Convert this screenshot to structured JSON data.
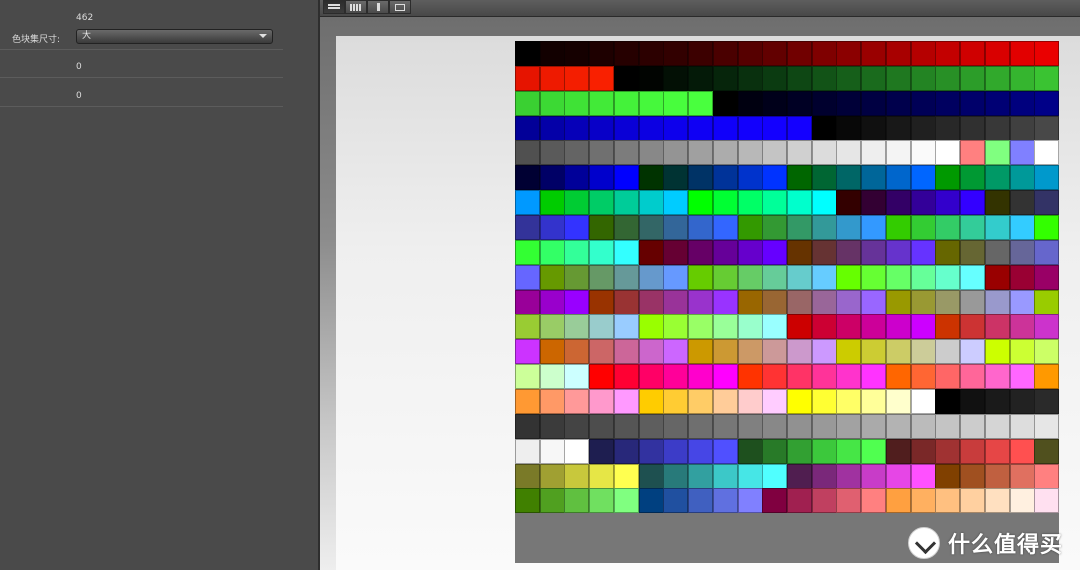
{
  "panel": {
    "count": "462",
    "size_label": "色块集尺寸:",
    "size_value": "大",
    "field1": "0",
    "field2": "0"
  },
  "toolbar": {
    "buttons": [
      "list-view-icon",
      "grid-view-icon",
      "split-view-icon",
      "image-view-icon"
    ],
    "active": "list-view-icon"
  },
  "swatches": {
    "columns": 22,
    "rows": 21,
    "colors": [
      "#000000",
      "#120000",
      "#150000",
      "#1e0000",
      "#260000",
      "#2c0000",
      "#320000",
      "#3c0000",
      "#4a0000",
      "#560000",
      "#620000",
      "#710000",
      "#7f0000",
      "#8b0000",
      "#9a0000",
      "#a80000",
      "#b50000",
      "#c30000",
      "#cf0000",
      "#d90000",
      "#e20000",
      "#ea0000",
      "#e61400",
      "#ee1a00",
      "#f41e00",
      "#f92000",
      "#000000",
      "#010401",
      "#031005",
      "#041a08",
      "#06250b",
      "#09300e",
      "#0b3b11",
      "#0e4714",
      "#125317",
      "#165f1a",
      "#1a6b1d",
      "#1f7820",
      "#238423",
      "#289026",
      "#2c9d29",
      "#31a92c",
      "#35b52f",
      "#3ac332",
      "#3ad032",
      "#3cd934",
      "#3fe236",
      "#42ea38",
      "#44f23a",
      "#46f83c",
      "#48fd3d",
      "#49ff3e",
      "#000000",
      "#000010",
      "#00001a",
      "#000024",
      "#00002e",
      "#000038",
      "#000042",
      "#00004c",
      "#000056",
      "#000060",
      "#00006a",
      "#000074",
      "#00007e",
      "#000088",
      "#020098",
      "#0400a8",
      "#0600b8",
      "#0800c8",
      "#0a00d6",
      "#0c00e2",
      "#0d00ec",
      "#0f00f4",
      "#1000fa",
      "#1200fd",
      "#1300ff",
      "#1400ff",
      "#000000",
      "#080808",
      "#101010",
      "#181818",
      "#202020",
      "#282828",
      "#303030",
      "#383838",
      "#404040",
      "#484848",
      "#505050",
      "#5a5a5a",
      "#646464",
      "#707070",
      "#7c7c7c",
      "#888888",
      "#949494",
      "#a0a0a0",
      "#acacac",
      "#b8b8b8",
      "#c4c4c4",
      "#d0d0d0",
      "#dcdcdc",
      "#e6e6e6",
      "#eeeeee",
      "#f4f4f4",
      "#fafafa",
      "#ffffff",
      "#ff8080",
      "#80ff80",
      "#8080ff",
      "#ffffff",
      "#000033",
      "#000066",
      "#000099",
      "#0000cc",
      "#0000ff",
      "#003300",
      "#003333",
      "#003366",
      "#003399",
      "#0033cc",
      "#0033ff",
      "#006600",
      "#006633",
      "#006666",
      "#006699",
      "#0066cc",
      "#0066ff",
      "#009900",
      "#009933",
      "#009966",
      "#009999",
      "#0099cc",
      "#0099ff",
      "#00cc00",
      "#00cc33",
      "#00cc66",
      "#00cc99",
      "#00cccc",
      "#00ccff",
      "#00ff00",
      "#00ff33",
      "#00ff66",
      "#00ff99",
      "#00ffcc",
      "#00ffff",
      "#330000",
      "#330033",
      "#330066",
      "#330099",
      "#3300cc",
      "#3300ff",
      "#333300",
      "#333333",
      "#333366",
      "#333399",
      "#3333cc",
      "#3333ff",
      "#336600",
      "#336633",
      "#336666",
      "#336699",
      "#3366cc",
      "#3366ff",
      "#339900",
      "#339933",
      "#339966",
      "#339999",
      "#3399cc",
      "#3399ff",
      "#33cc00",
      "#33cc33",
      "#33cc66",
      "#33cc99",
      "#33cccc",
      "#33ccff",
      "#33ff00",
      "#33ff33",
      "#33ff66",
      "#33ff99",
      "#33ffcc",
      "#33ffff",
      "#660000",
      "#660033",
      "#660066",
      "#660099",
      "#6600cc",
      "#6600ff",
      "#663300",
      "#663333",
      "#663366",
      "#663399",
      "#6633cc",
      "#6633ff",
      "#666600",
      "#666633",
      "#666666",
      "#666699",
      "#6666cc",
      "#6666ff",
      "#669900",
      "#669933",
      "#669966",
      "#669999",
      "#6699cc",
      "#6699ff",
      "#66cc00",
      "#66cc33",
      "#66cc66",
      "#66cc99",
      "#66cccc",
      "#66ccff",
      "#66ff00",
      "#66ff33",
      "#66ff66",
      "#66ff99",
      "#66ffcc",
      "#66ffff",
      "#990000",
      "#990033",
      "#990066",
      "#990099",
      "#9900cc",
      "#9900ff",
      "#993300",
      "#993333",
      "#993366",
      "#993399",
      "#9933cc",
      "#9933ff",
      "#996600",
      "#996633",
      "#996666",
      "#996699",
      "#9966cc",
      "#9966ff",
      "#999900",
      "#999933",
      "#999966",
      "#999999",
      "#9999cc",
      "#9999ff",
      "#99cc00",
      "#99cc33",
      "#99cc66",
      "#99cc99",
      "#99cccc",
      "#99ccff",
      "#99ff00",
      "#99ff33",
      "#99ff66",
      "#99ff99",
      "#99ffcc",
      "#99ffff",
      "#cc0000",
      "#cc0033",
      "#cc0066",
      "#cc0099",
      "#cc00cc",
      "#cc00ff",
      "#cc3300",
      "#cc3333",
      "#cc3366",
      "#cc3399",
      "#cc33cc",
      "#cc33ff",
      "#cc6600",
      "#cc6633",
      "#cc6666",
      "#cc6699",
      "#cc66cc",
      "#cc66ff",
      "#cc9900",
      "#cc9933",
      "#cc9966",
      "#cc9999",
      "#cc99cc",
      "#cc99ff",
      "#cccc00",
      "#cccc33",
      "#cccc66",
      "#cccc99",
      "#cccccc",
      "#ccccff",
      "#ccff00",
      "#ccff33",
      "#ccff66",
      "#ccff99",
      "#ccffcc",
      "#ccffff",
      "#ff0000",
      "#ff0033",
      "#ff0066",
      "#ff0099",
      "#ff00cc",
      "#ff00ff",
      "#ff3300",
      "#ff3333",
      "#ff3366",
      "#ff3399",
      "#ff33cc",
      "#ff33ff",
      "#ff6600",
      "#ff6633",
      "#ff6666",
      "#ff6699",
      "#ff66cc",
      "#ff66ff",
      "#ff9900",
      "#ff9933",
      "#ff9966",
      "#ff9999",
      "#ff99cc",
      "#ff99ff",
      "#ffcc00",
      "#ffcc33",
      "#ffcc66",
      "#ffcc99",
      "#ffcccc",
      "#ffccff",
      "#ffff00",
      "#ffff33",
      "#ffff66",
      "#ffff99",
      "#ffffcc",
      "#ffffff",
      "#000000",
      "#111111",
      "#1a1a1a",
      "#222222",
      "#2a2a2a",
      "#333333",
      "#3b3b3b",
      "#444444",
      "#4d4d4d",
      "#555555",
      "#5e5e5e",
      "#666666",
      "#6f6f6f",
      "#777777",
      "#808080",
      "#888888",
      "#919191",
      "#999999",
      "#a2a2a2",
      "#aaaaaa",
      "#b3b3b3",
      "#bbbbbb",
      "#c4c4c4",
      "#cccccc",
      "#d5d5d5",
      "#dddddd",
      "#e6e6e6",
      "#eeeeee",
      "#f7f7f7",
      "#ffffff",
      "#1e1e50",
      "#28287a",
      "#3232a0",
      "#3c3cc8",
      "#4646e6",
      "#5050ff",
      "#1e501e",
      "#287a28",
      "#32a032",
      "#3cc83c",
      "#46e646",
      "#50ff50",
      "#501e1e",
      "#7a2828",
      "#a03232",
      "#c83c3c",
      "#e64646",
      "#ff5050",
      "#50501e",
      "#7a7a28",
      "#a0a032",
      "#c8c83c",
      "#e6e646",
      "#ffff50",
      "#1e5050",
      "#287a7a",
      "#32a0a0",
      "#3cc8c8",
      "#46e6e6",
      "#50ffff",
      "#501e50",
      "#7a287a",
      "#a032a0",
      "#c83cc8",
      "#e646e6",
      "#ff50ff",
      "#804000",
      "#a05020",
      "#c06040",
      "#e07060",
      "#ff8080",
      "#408000",
      "#50a020",
      "#60c040",
      "#70e060",
      "#80ff80",
      "#004080",
      "#2050a0",
      "#4060c0",
      "#6070e0",
      "#8080ff",
      "#800040",
      "#a02050",
      "#c04060",
      "#e06070",
      "#ff8080",
      "#ffa040",
      "#ffb060",
      "#ffc080",
      "#ffd0a0",
      "#ffe0c0",
      "#fff0e0",
      "#ffe0f0"
    ]
  }
}
